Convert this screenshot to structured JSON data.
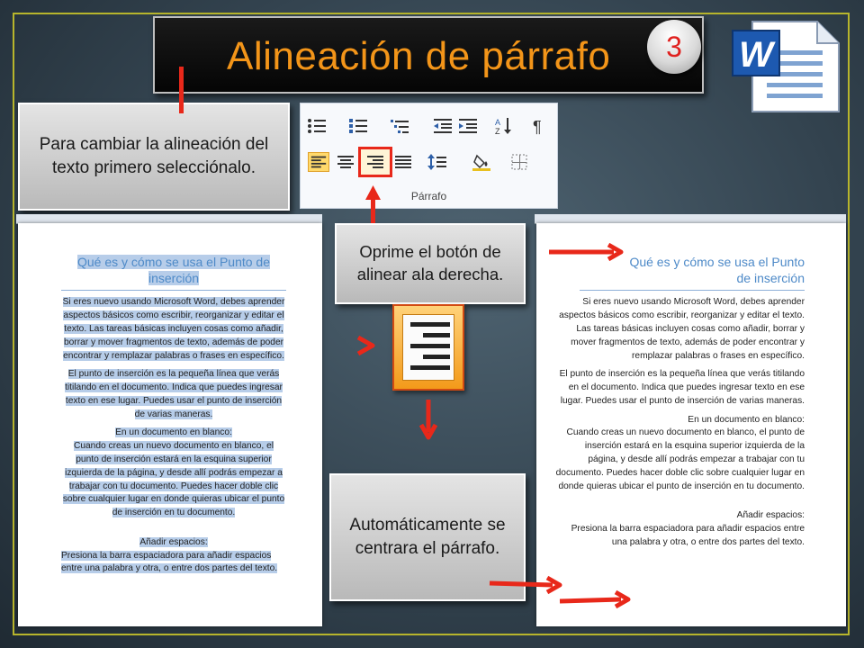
{
  "title": "Alineación de párrafo",
  "step_number": "3",
  "app_logo": "word-logo-icon",
  "callouts": {
    "select_text": "Para cambiar la alineación del texto primero selecciónalo.",
    "press_button": "Oprime el botón de alinear ala derecha.",
    "result": "Automáticamente se centrara el párrafo."
  },
  "ribbon": {
    "group_label": "Párrafo",
    "icons": [
      "bullets-icon",
      "numbering-icon",
      "multilevel-list-icon",
      "decrease-indent-icon",
      "increase-indent-icon",
      "sort-icon",
      "show-formatting-icon",
      "align-left-icon",
      "align-center-icon",
      "align-right-icon",
      "justify-icon",
      "line-spacing-icon",
      "shading-icon",
      "borders-icon"
    ]
  },
  "document": {
    "heading": "Qué es y cómo se usa el Punto de inserción",
    "p1": "Si eres nuevo usando Microsoft Word, debes aprender aspectos básicos como escribir, reorganizar y editar el texto. Las tareas básicas incluyen cosas como añadir, borrar y mover fragmentos de texto, además de poder encontrar y remplazar palabras o frases en específico.",
    "p2": "El punto de inserción es la pequeña línea que verás titilando en el documento. Indica que puedes ingresar texto en ese lugar. Puedes usar el punto de inserción de varias maneras.",
    "sub1": "En un documento en blanco:",
    "p3": "Cuando creas un nuevo documento en blanco, el punto de inserción estará en la esquina superior izquierda de la página, y desde allí podrás empezar a trabajar con tu documento. Puedes hacer doble clic sobre cualquier lugar en donde quieras ubicar el punto de inserción en tu documento.",
    "sub2": "Añadir espacios:",
    "p4": "Presiona la barra espaciadora para añadir espacios entre una palabra y otra, o entre dos partes del texto."
  },
  "colors": {
    "title": "#f39519",
    "highlight": "#b7cde9",
    "heading": "#4e8ac8",
    "arrow": "#e8281a",
    "frame": "#b7b52c"
  }
}
